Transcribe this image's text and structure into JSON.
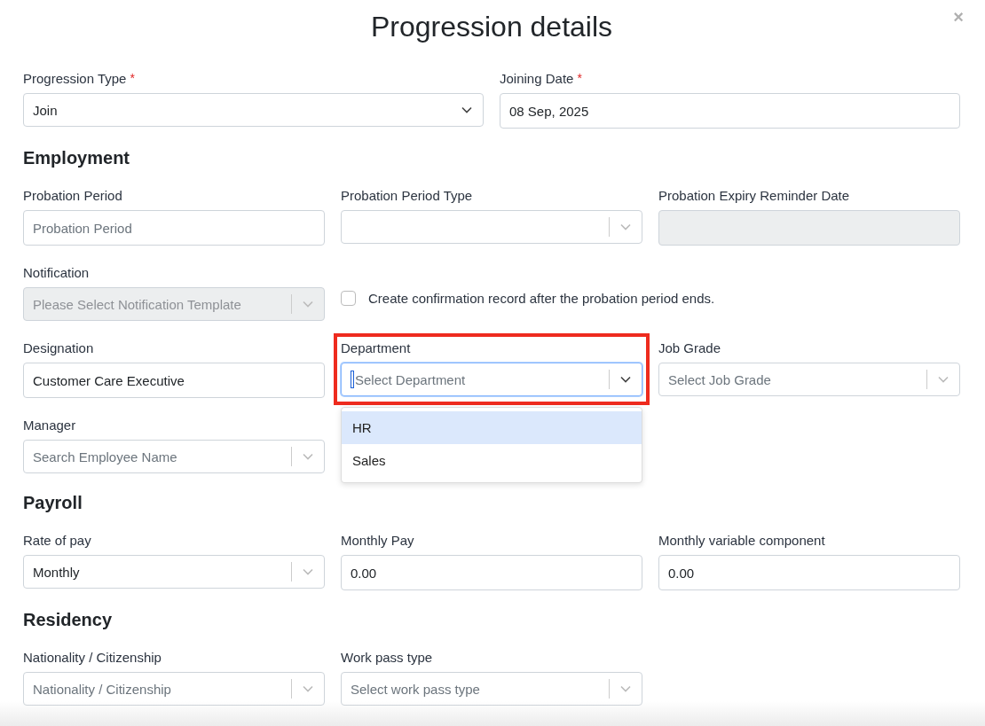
{
  "title": "Progression details",
  "close": "×",
  "top_row": [
    {
      "label": "Progression Type",
      "required": "*",
      "kind": "select",
      "value": "Join"
    },
    {
      "label": "Joining Date",
      "required": "*",
      "kind": "text",
      "value": "08 Sep, 2025"
    }
  ],
  "sections": [
    {
      "heading": "Employment",
      "rows": [
        [
          {
            "label": "Probation Period",
            "kind": "text",
            "placeholder": "Probation Period"
          },
          {
            "label": "Probation Period Type",
            "kind": "combobox"
          },
          {
            "label": "Probation Expiry Reminder Date",
            "kind": "text",
            "disabled": true
          }
        ],
        [
          {
            "label": "Notification",
            "kind": "combobox",
            "placeholder": "Please Select Notification Template",
            "disabled": true
          },
          {
            "label": "Create confirmation record after the probation period ends.",
            "kind": "checkbox",
            "checked": false
          }
        ],
        [
          {
            "label": "Designation",
            "kind": "text",
            "value": "Customer Care Executive"
          },
          {
            "label": "Department",
            "kind": "combobox",
            "placeholder": "Select Department",
            "focused": true,
            "highlighted": true,
            "options": [
              {
                "label": "HR",
                "selected": true
              },
              {
                "label": "Sales",
                "selected": false
              }
            ]
          },
          {
            "label": "Job Grade",
            "kind": "combobox",
            "placeholder": "Select Job Grade"
          }
        ],
        [
          {
            "label": "Manager",
            "kind": "combobox",
            "placeholder": "Search Employee Name"
          }
        ]
      ]
    },
    {
      "heading": "Payroll",
      "rows": [
        [
          {
            "label": "Rate of pay",
            "kind": "combobox",
            "value": "Monthly"
          },
          {
            "label": "Monthly Pay",
            "kind": "text",
            "value": "0.00"
          },
          {
            "label": "Monthly variable component",
            "kind": "text",
            "value": "0.00"
          }
        ]
      ]
    },
    {
      "heading": "Residency",
      "rows": [
        [
          {
            "label": "Nationality / Citizenship",
            "kind": "combobox",
            "placeholder": "Nationality / Citizenship"
          },
          {
            "label": "Work pass type",
            "kind": "combobox",
            "placeholder": "Select work pass type"
          }
        ]
      ]
    }
  ]
}
